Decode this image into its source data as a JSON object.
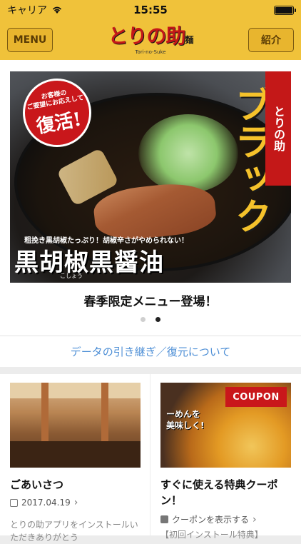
{
  "status_bar": {
    "carrier": "キャリア",
    "time": "15:55",
    "icons": [
      "wifi-icon",
      "battery-icon"
    ]
  },
  "header": {
    "menu_label": "MENU",
    "logo_text": "とりの助",
    "logo_badge": "麺",
    "logo_sub": "Tori-no-Suke",
    "intro_label": "紹介"
  },
  "banner": {
    "sticker_top": "お客様の\nご要望にお応えして",
    "sticker_main": "復活!",
    "brand_tag": "とりの助",
    "title_vertical": "ブラック",
    "tagline": "粗挽き黒胡椒たっぷり！胡椒辛さがやめられない！",
    "dish_name": "黒胡椒黒醤油",
    "ruby": "こしょう",
    "caption": "春季限定メニュー登場！",
    "carousel_count": 2,
    "carousel_active": 2
  },
  "data_transfer_link": "データの引き継ぎ／復元について",
  "cards": [
    {
      "title": "ごあいさつ",
      "date": "2017.04.19",
      "excerpt": "とりの助アプリをインストールいただきありがとう"
    },
    {
      "badge": "COUPON",
      "image_text": "ーめんを\n美味しく!",
      "title": "すぐに使える特典クーポン！",
      "action": "クーポンを表示する",
      "excerpt": "【初回インストール特典】"
    }
  ],
  "colors": {
    "brand_yellow": "#f0c23a",
    "link_blue": "#4e8fd6",
    "brand_red": "#c41818"
  }
}
